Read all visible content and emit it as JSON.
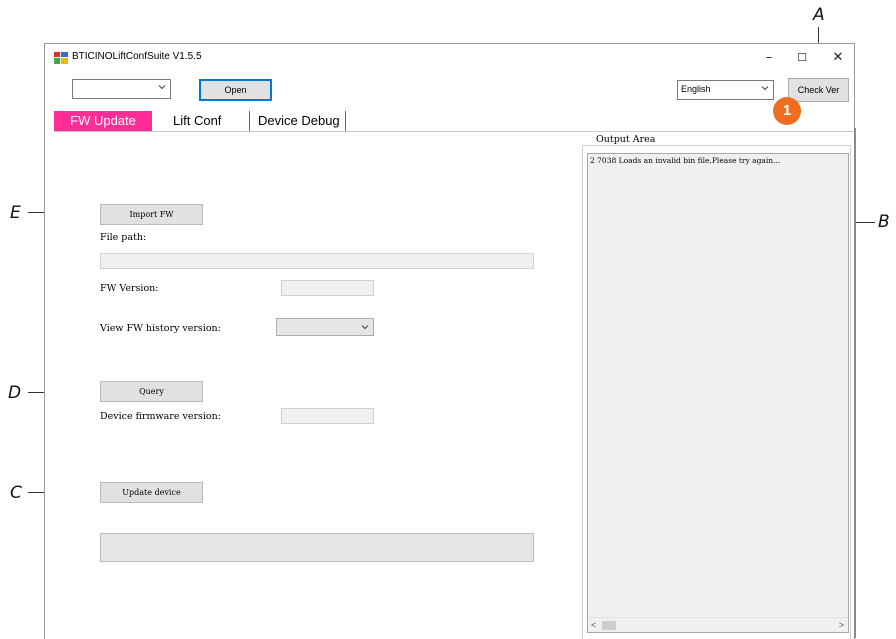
{
  "annotations": {
    "a": "A",
    "b": "B",
    "c": "C",
    "d": "D",
    "e": "E"
  },
  "badge": "1",
  "window": {
    "title": "BTICINOLiftConfSuite V1.5.5",
    "minimize": "–",
    "maximize": "☐",
    "close": "✕"
  },
  "toolbar": {
    "port_value": "",
    "open_label": "Open",
    "language_value": "English",
    "check_ver_label": "Check Ver"
  },
  "tabs": [
    {
      "label": "FW Update",
      "active": true
    },
    {
      "label": "Lift Conf",
      "active": false
    },
    {
      "label": "Device Debug",
      "active": false
    }
  ],
  "fw_update": {
    "import_fw_label": "Import FW",
    "file_path_label": "File path:",
    "file_path_value": "",
    "fw_version_label": "FW Version:",
    "fw_version_value": "",
    "history_label": "View FW history version:",
    "history_value": "",
    "query_label": "Query",
    "device_fw_label": "Device firmware version:",
    "device_fw_value": "",
    "update_label": "Update device",
    "progress_value": ""
  },
  "output": {
    "legend": "Output Area",
    "lines": [
      "2 7038  Loads an invalid bin file,Please try again..."
    ]
  },
  "colors": {
    "active_tab": "#ff2d96",
    "badge": "#ef6d1e",
    "button_focus": "#0078d7"
  },
  "icons": {
    "app": "app-icon",
    "dropdown": "chevron-down-icon"
  }
}
